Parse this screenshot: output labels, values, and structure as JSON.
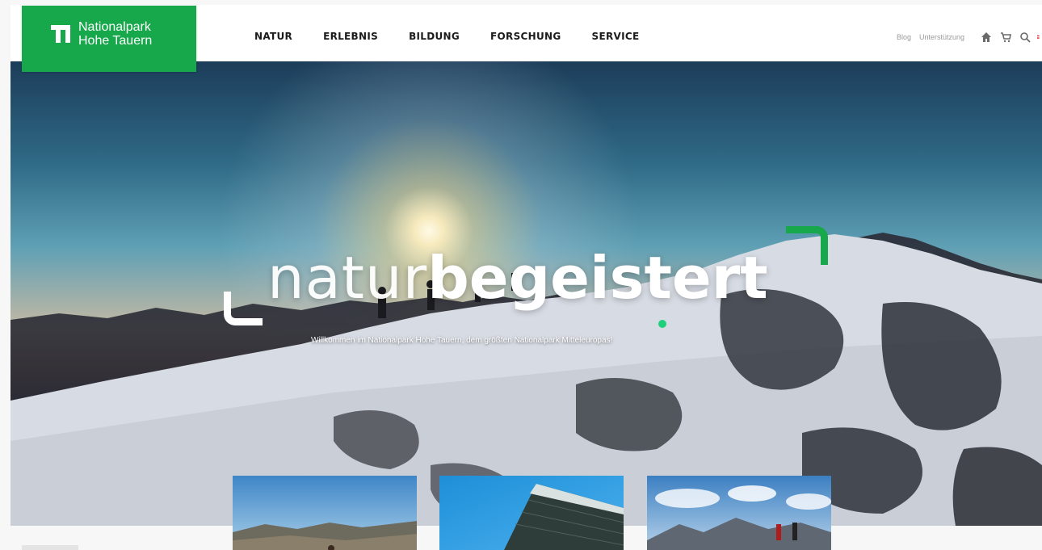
{
  "logo": {
    "line1": "Nationalpark",
    "line2": "Hohe Tauern"
  },
  "nav": {
    "items": [
      "NATUR",
      "ERLEBNIS",
      "BILDUNG",
      "FORSCHUNG",
      "SERVICE"
    ]
  },
  "utility": {
    "links": [
      "Blog",
      "Unterstützung"
    ],
    "icons": [
      "home-icon",
      "cart-icon",
      "search-icon",
      "language-icon"
    ]
  },
  "hero": {
    "headline_light": "natur",
    "headline_bold": "begeistert",
    "tagline": "Willkommen im Nationalpark Hohe Tauern, dem größten Nationalpark Mitteleuropas!"
  },
  "cards": [
    {
      "name": "teaser-card-hikers"
    },
    {
      "name": "teaser-card-building"
    },
    {
      "name": "teaser-card-mountains"
    }
  ],
  "colors": {
    "brand_green": "#17a84b",
    "accent_dot": "#1fd07a",
    "nav_text": "#1b1b1b"
  }
}
